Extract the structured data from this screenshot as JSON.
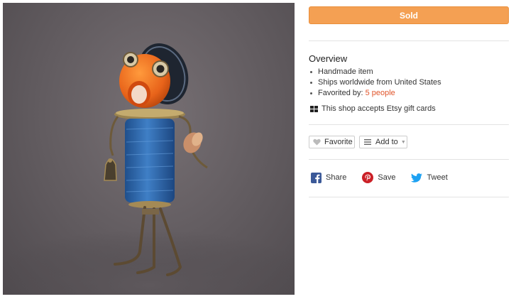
{
  "listing": {
    "status_button": "Sold",
    "overview": {
      "title": "Overview",
      "items": [
        "Handmade item",
        "Ships worldwide from United States"
      ],
      "favorited_label": "Favorited by:",
      "favorited_link": "5 people"
    },
    "gift_card_note": "This shop accepts Etsy gift cards",
    "actions": {
      "favorite_label": "Favorite",
      "add_to_label": "Add to"
    },
    "share": {
      "facebook_label": "Share",
      "pinterest_label": "Save",
      "twitter_label": "Tweet"
    }
  },
  "icons": {
    "favorite": "heart-icon",
    "add_to": "list-menu-icon",
    "gift_card": "gift-card-icon",
    "facebook": "facebook-icon",
    "pinterest": "pinterest-icon",
    "twitter": "twitter-icon"
  },
  "colors": {
    "sold_button": "#f4a053",
    "link": "#e0552b",
    "facebook": "#3b5998",
    "pinterest": "#cb2027",
    "twitter": "#1da1f2"
  }
}
